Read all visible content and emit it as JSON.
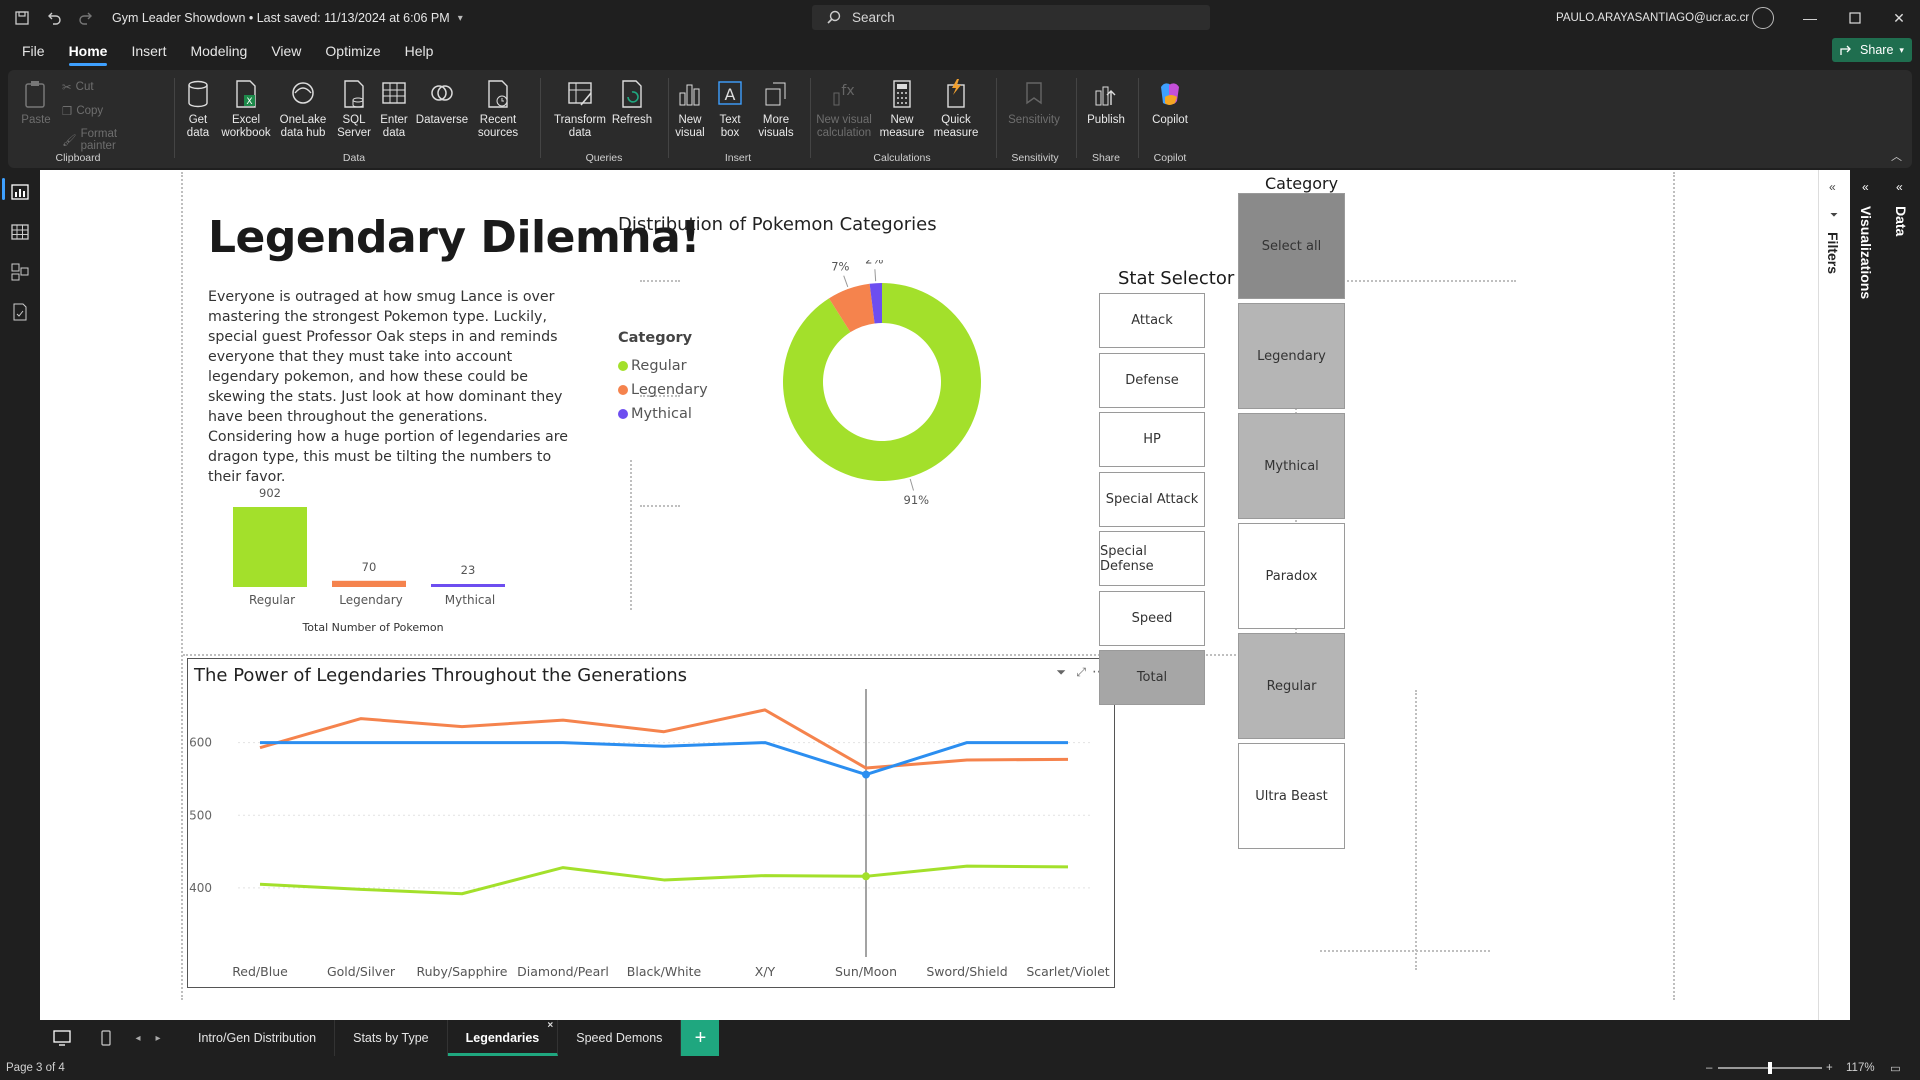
{
  "titlebar": {
    "doc_title": "Gym Leader Showdown • Last saved: 11/13/2024 at 6:06 PM",
    "search_placeholder": "Search",
    "user_email": "PAULO.ARAYASANTIAGO@ucr.ac.cr"
  },
  "menu": {
    "tabs": [
      "File",
      "Home",
      "Insert",
      "Modeling",
      "View",
      "Optimize",
      "Help"
    ],
    "active": "Home",
    "share_label": "Share"
  },
  "ribbon": {
    "clipboard": {
      "label": "Clipboard",
      "paste": "Paste",
      "cut": "Cut",
      "copy": "Copy",
      "format_painter": "Format painter"
    },
    "data": {
      "label": "Data",
      "get_data": "Get data",
      "excel": "Excel workbook",
      "onelake": "OneLake data hub",
      "sql": "SQL Server",
      "enter_data": "Enter data",
      "dataverse": "Dataverse",
      "recent": "Recent sources"
    },
    "queries": {
      "label": "Queries",
      "transform": "Transform data",
      "refresh": "Refresh"
    },
    "insert": {
      "label": "Insert",
      "new_visual": "New visual",
      "text_box": "Text box",
      "more_visuals": "More visuals"
    },
    "calculations": {
      "label": "Calculations",
      "new_visual_calc": "New visual calculation",
      "new_measure": "New measure",
      "quick_measure": "Quick measure"
    },
    "sensitivity": {
      "label": "Sensitivity",
      "sensitivity": "Sensitivity"
    },
    "share": {
      "label": "Share",
      "publish": "Publish"
    },
    "copilot": {
      "label": "Copilot",
      "copilot": "Copilot"
    }
  },
  "report": {
    "title": "Legendary Dilemna!",
    "body": "Everyone is outraged at how smug Lance is over mastering the strongest Pokemon type. Luckily, special guest Professor Oak steps in and reminds everyone that they must take into account legendary pokemon, and how these could be skewing the stats. Just look at how dominant they have been throughout the generations. Considering how a huge portion of legendaries are dragon type, this must be tilting the numbers to their favor."
  },
  "colors": {
    "regular": "#a3e02b",
    "legendary": "#f5834d",
    "mythical": "#6d4ef0",
    "total_line": "#2b8ef0"
  },
  "chart_data": [
    {
      "type": "bar",
      "title": "",
      "categories": [
        "Regular",
        "Legendary",
        "Mythical"
      ],
      "values": [
        902,
        70,
        23
      ],
      "data_labels": [
        "902",
        "70",
        "23"
      ],
      "xlabel": "Total Number of Pokemon",
      "ylabel": ""
    },
    {
      "type": "pie",
      "title": "Distribution of Pokemon Categories",
      "legend_title": "Category",
      "categories": [
        "Regular",
        "Legendary",
        "Mythical"
      ],
      "values": [
        91,
        7,
        2
      ],
      "data_labels": [
        "91%",
        "7%",
        "2%"
      ]
    },
    {
      "type": "line",
      "title": "The Power of Legendaries Throughout the Generations",
      "categories": [
        "Red/Blue",
        "Gold/Silver",
        "Ruby/Sapphire",
        "Diamond/Pearl",
        "Black/White",
        "X/Y",
        "Sun/Moon",
        "Sword/Shield",
        "Scarlet/Violet"
      ],
      "yticks": [
        "600",
        "500",
        "400"
      ],
      "ylim": [
        360,
        660
      ],
      "series": [
        {
          "values": [
            593,
            633,
            622,
            631,
            615,
            645,
            565,
            576,
            577
          ]
        },
        {
          "values": [
            600,
            600,
            600,
            600,
            595,
            600,
            556,
            600,
            600
          ]
        },
        {
          "values": [
            405,
            398,
            392,
            428,
            411,
            417,
            416,
            430,
            429
          ]
        }
      ]
    }
  ],
  "stat_selector": {
    "title": "Stat Selector",
    "options": [
      "Attack",
      "Defense",
      "HP",
      "Special Attack",
      "Special Defense",
      "Speed",
      "Total"
    ],
    "selected": "Total"
  },
  "category_slicer": {
    "title": "Category",
    "options": [
      "Select all",
      "Legendary",
      "Mythical",
      "Paradox",
      "Regular",
      "Ultra Beast"
    ]
  },
  "panes": {
    "filters": "Filters",
    "visualizations": "Visualizations",
    "data": "Data"
  },
  "pages": {
    "tabs": [
      "Intro/Gen Distribution",
      "Stats by Type",
      "Legendaries",
      "Speed Demons"
    ],
    "active": "Legendaries"
  },
  "status": {
    "page": "Page 3 of 4",
    "zoom": "117%"
  }
}
